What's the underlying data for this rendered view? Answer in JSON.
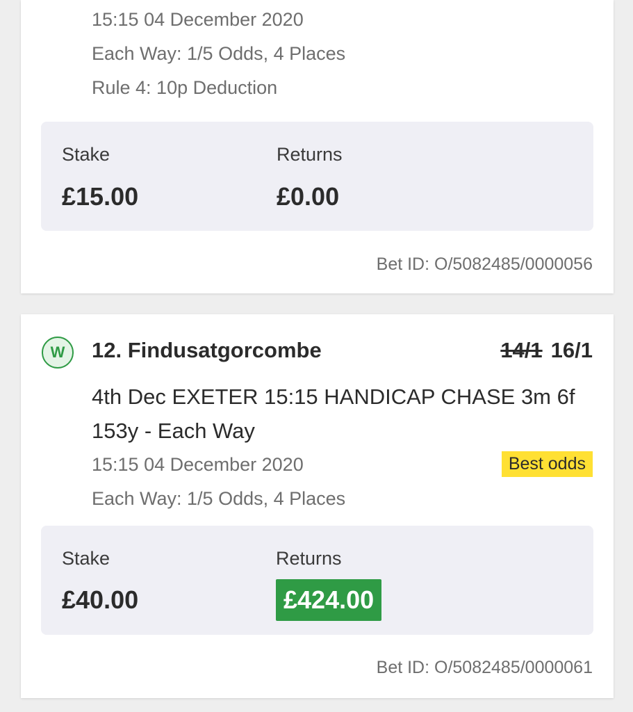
{
  "bets": [
    {
      "datetime": "15:15 04 December 2020",
      "each_way": "Each Way: 1/5 Odds, 4 Places",
      "rule4": "Rule 4: 10p Deduction",
      "stake_label": "Stake",
      "stake_value": "£15.00",
      "returns_label": "Returns",
      "returns_value": "£0.00",
      "bet_id": "Bet ID: O/5082485/0000056"
    },
    {
      "status_icon": "W",
      "selection": "12. Findusatgorcombe",
      "odds_old": "14/1",
      "odds_new": "16/1",
      "event": "4th Dec EXETER 15:15 HANDICAP CHASE 3m 6f 153y - Each Way",
      "datetime": "15:15 04 December 2020",
      "badge": "Best odds",
      "each_way": "Each Way: 1/5 Odds, 4 Places",
      "stake_label": "Stake",
      "stake_value": "£40.00",
      "returns_label": "Returns",
      "returns_value": "£424.00",
      "bet_id": "Bet ID: O/5082485/0000061"
    }
  ],
  "colors": {
    "win_green": "#2f9b45",
    "badge_yellow": "#ffe033",
    "summary_bg": "#efeff5"
  }
}
